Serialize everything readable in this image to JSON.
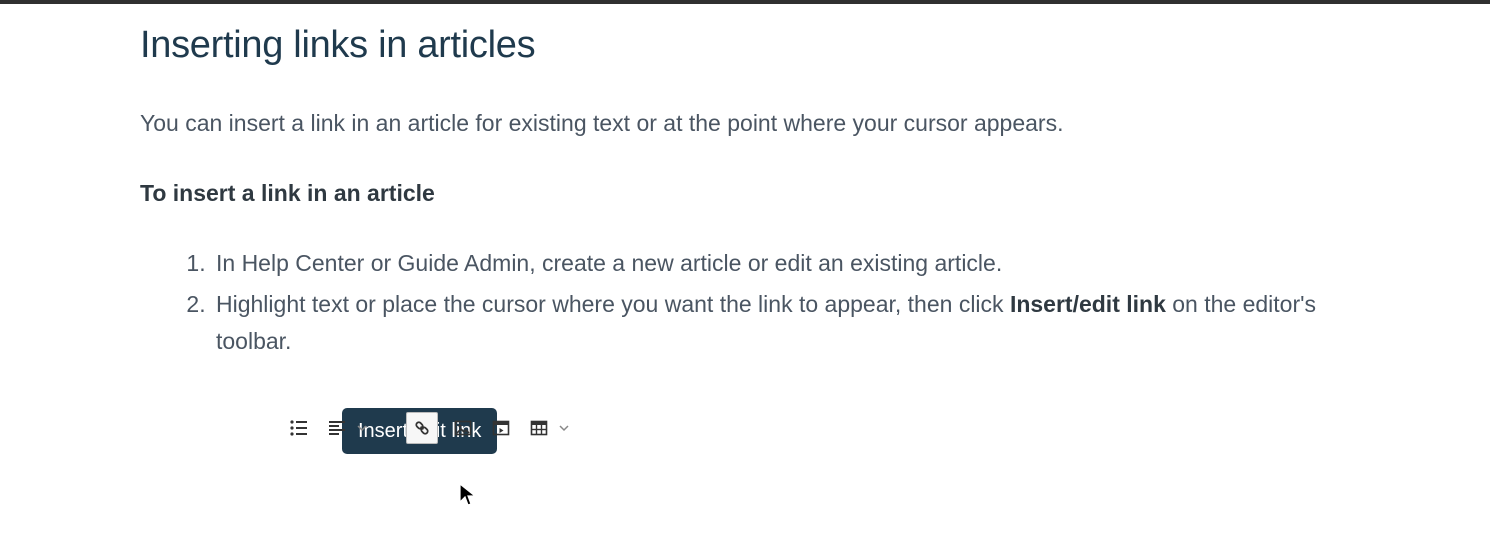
{
  "article": {
    "title": "Inserting links in articles",
    "intro": "You can insert a link in an article for existing text or at the point where your cursor appears.",
    "subheading": "To insert a link in an article",
    "step1": "In Help Center or Guide Admin, create a new article or edit an existing article.",
    "step2_a": "Highlight text or place the cursor where you want the link to appear, then click ",
    "step2_bold": "Insert/edit link",
    "step2_b": " on the editor's toolbar."
  },
  "toolbar": {
    "tooltip": "Insert/edit link",
    "icons": {
      "list": "bullet-list-icon",
      "align": "align-left-icon",
      "link": "link-icon",
      "image": "image-icon",
      "video": "video-icon",
      "table": "table-icon"
    }
  }
}
